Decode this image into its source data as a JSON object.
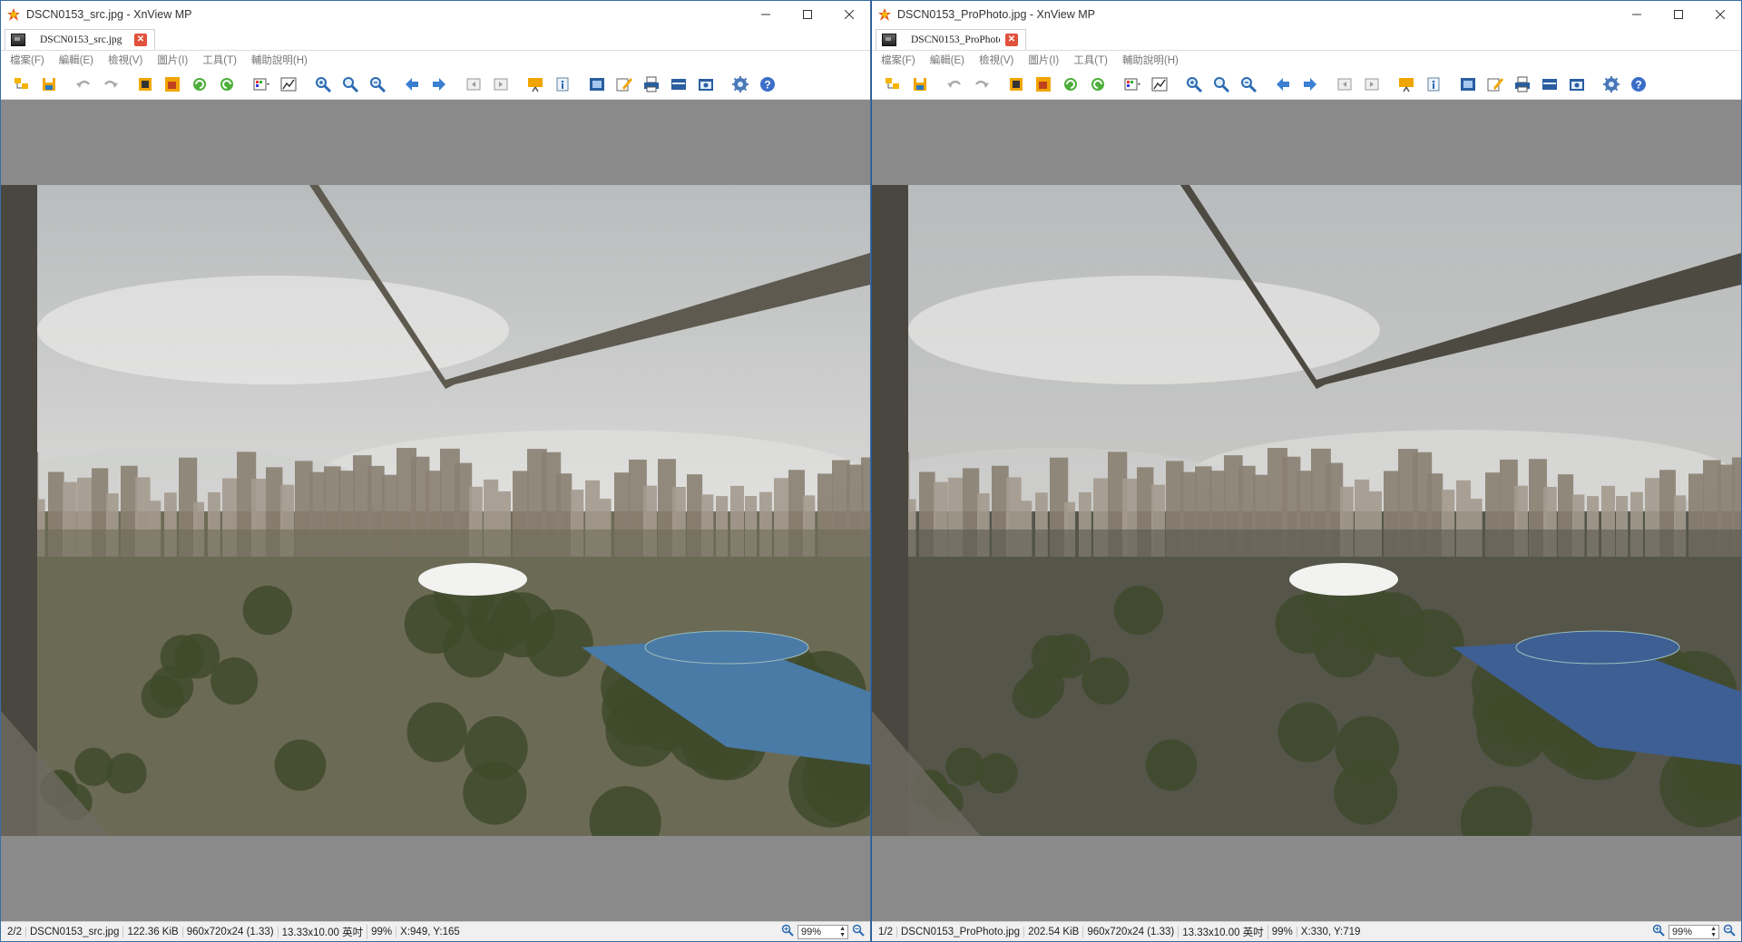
{
  "windows": [
    {
      "title": "DSCN0153_src.jpg - XnView MP",
      "tab_label": "DSCN0153_src.jpg",
      "menu": [
        "檔案(F)",
        "編輯(E)",
        "檢視(V)",
        "圖片(I)",
        "工具(T)",
        "輔助說明(H)"
      ],
      "status": {
        "index": "2/2",
        "filename": "DSCN0153_src.jpg",
        "filesize": "122.36 KiB",
        "dimensions": "960x720x24 (1.33)",
        "print_size": "13.33x10.00 英吋",
        "zoom": "99%",
        "cursor": "X:949, Y:165",
        "zoom_input": "99%"
      },
      "photo_tone": {
        "sky": "#d8d8d6",
        "ground": "#6b6a55",
        "roof": "#4a7aa6",
        "frame": "#5e5a50"
      }
    },
    {
      "title": "DSCN0153_ProPhoto.jpg - XnView MP",
      "tab_label": "DSCN0153_ProPhoto.jp...",
      "menu": [
        "檔案(F)",
        "編輯(E)",
        "檢視(V)",
        "圖片(I)",
        "工具(T)",
        "輔助說明(H)"
      ],
      "status": {
        "index": "1/2",
        "filename": "DSCN0153_ProPhoto.jpg",
        "filesize": "202.54 KiB",
        "dimensions": "960x720x24 (1.33)",
        "print_size": "13.33x10.00 英吋",
        "zoom": "99%",
        "cursor": "X:330, Y:719",
        "zoom_input": "99%"
      },
      "photo_tone": {
        "sky": "#c8c8c6",
        "ground": "#55554a",
        "roof": "#3e5f93",
        "frame": "#4d4a42"
      }
    }
  ],
  "toolbar_icons": [
    "browser-icon",
    "save-icon",
    "undo-icon",
    "redo-icon",
    "crop-icon",
    "resize-icon",
    "rotate-left-icon",
    "rotate-right-icon",
    "adjust-colors-icon",
    "levels-icon",
    "zoom-in-icon",
    "zoom-fit-icon",
    "zoom-out-icon",
    "previous-icon",
    "next-icon",
    "first-icon",
    "last-icon",
    "slideshow-icon",
    "info-icon",
    "fullscreen-icon",
    "edit-icon",
    "print-icon",
    "scan-icon",
    "capture-icon",
    "settings-icon",
    "help-icon"
  ]
}
